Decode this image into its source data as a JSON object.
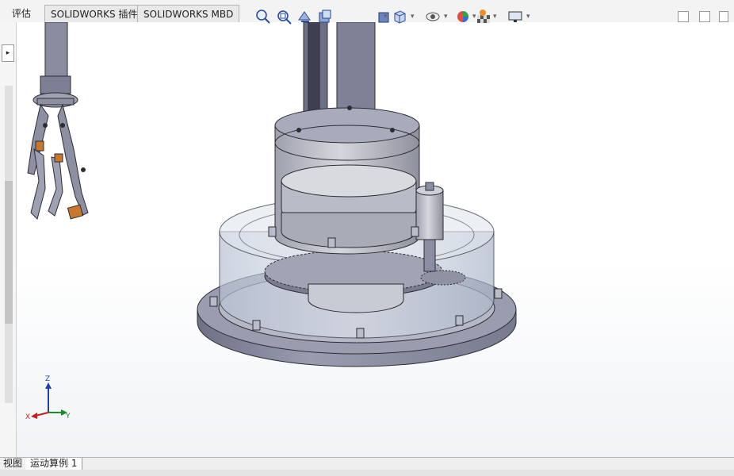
{
  "tabs": {
    "evaluate": "评估",
    "solidworks_addins": "SOLIDWORKS 插件",
    "solidworks_mbd": "SOLIDWORKS MBD"
  },
  "heads_up_toolbar": {
    "icons": [
      "zoom-to-fit-icon",
      "zoom-to-area-icon",
      "previous-view-icon",
      "section-view-icon",
      "view-orientation-icon",
      "display-style-icon",
      "hide-show-items-icon",
      "edit-appearance-icon",
      "apply-scene-icon",
      "view-settings-icon"
    ]
  },
  "triad": {
    "x": "X",
    "y": "Y",
    "z": "Z"
  },
  "bottom_tabs": {
    "view_tab": "视图",
    "motion_study": "运动算例 1"
  },
  "colors": {
    "part_gray": "#8c8fa3",
    "glass": "#c9d3e4",
    "accent_orange": "#c8782c"
  }
}
